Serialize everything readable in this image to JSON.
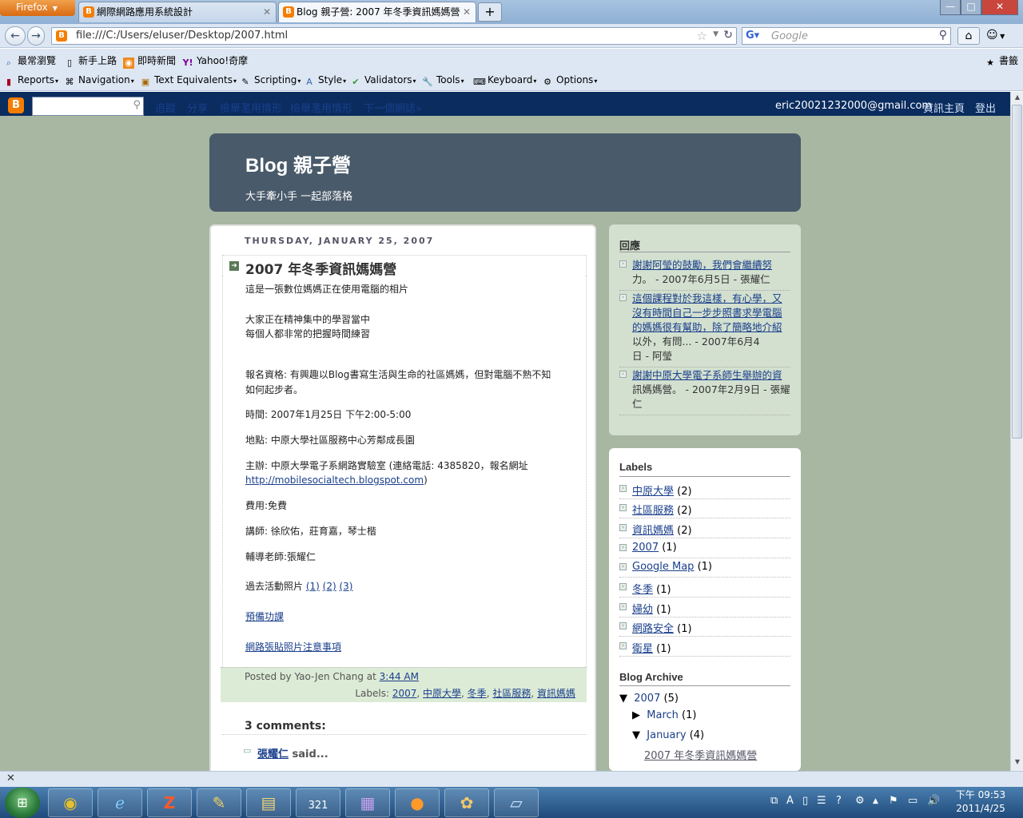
{
  "browser": {
    "app_button": "Firefox",
    "tabs": [
      {
        "label": "網際網路應用系統設計",
        "active": false
      },
      {
        "label": "Blog 親子營: 2007 年冬季資訊媽媽營",
        "active": true
      }
    ],
    "new_tab": "+",
    "url": "file:///C:/Users/eluser/Desktop/2007.html",
    "search_placeholder": "Google",
    "window_buttons": {
      "minimize": "—",
      "maximize": "□",
      "close": "✕"
    }
  },
  "bookmarks": {
    "items": [
      "最常瀏覽",
      "新手上路",
      "即時新聞",
      "Yahoo!奇摩"
    ],
    "right": "書籤"
  },
  "devbar": {
    "items": [
      "Reports",
      "Navigation",
      "Text Equivalents",
      "Scripting",
      "Style",
      "Validators",
      "Tools",
      "Keyboard",
      "Options"
    ]
  },
  "blogger_nav": {
    "links": [
      "追蹤",
      "分享",
      "檢舉濫用情形",
      "檢舉濫用情形",
      "下一個網誌»"
    ],
    "email": "eric20021232000@gmail.com",
    "dashboard": "資訊主頁",
    "signout": "登出"
  },
  "header": {
    "title": "Blog 親子營",
    "description": "大手牽小手 一起部落格"
  },
  "post": {
    "date": "THURSDAY, JANUARY 25, 2007",
    "title": "2007 年冬季資訊媽媽營",
    "lines": [
      "這是一張數位媽媽正在使用電腦的相片",
      "大家正在精神集中的學習當中",
      "每個人都非常的把握時間練習",
      "報名資格: 有興趣以Blog書寫生活與生命的社區媽媽，但對電腦不熟不知",
      "如何起步者。",
      "時間: 2007年1月25日 下午2:00-5:00",
      "地點: 中原大學社區服務中心芳鄰成長園",
      "主辦: 中原大學電子系網路實驗室 (連絡電話: 4385820，報名網址",
      "費用:免費",
      "講師: 徐欣佑，莊育嘉，琴士楷",
      "輔導老師:張耀仁",
      "過去活動照片 "
    ],
    "signup_url": "http://mobilesocialtech.blogspot.com",
    "close_paren": ")",
    "photo_links": [
      "(1)",
      "(2)",
      "(3)"
    ],
    "prep_link": "預備功課",
    "notice_link": "網路張貼照片注意事項",
    "posted_by": "Posted by Yao-Jen Chang at",
    "posted_time": "3:44 AM",
    "labels_prefix": "Labels:",
    "labels": [
      "2007",
      "中原大學",
      "冬季",
      "社區服務",
      "資訊媽媽"
    ],
    "comments_heading": "3 comments:",
    "comment_author": "張耀仁",
    "comment_said": "said..."
  },
  "sidebar": {
    "comments_title": "回應",
    "comments": [
      {
        "lines": [
          "謝謝阿瑩的鼓勵，我們會繼續努",
          "力。 - 2007年6月5日 - 張耀仁"
        ]
      },
      {
        "lines": [
          "這個課程對於我這樣，有心學，又",
          "沒有時間自己一步步照書求學電腦",
          "的媽媽很有幫助，除了簡略地介紹",
          "以外，有問... - 2007年6月4",
          "日 - 阿瑩"
        ]
      },
      {
        "lines": [
          "謝謝中原大學電子系師生舉辦的資",
          "訊媽媽營。 - 2007年2月9日 - 張耀",
          "仁"
        ]
      }
    ],
    "labels_title": "Labels",
    "labels": [
      {
        "name": "中原大學",
        "count": "(2)"
      },
      {
        "name": "社區服務",
        "count": "(2)"
      },
      {
        "name": "資訊媽媽",
        "count": "(2)"
      },
      {
        "name": "2007",
        "count": "(1)"
      },
      {
        "name": "Google Map",
        "count": "(1)"
      },
      {
        "name": "冬季",
        "count": "(1)"
      },
      {
        "name": "婦幼",
        "count": "(1)"
      },
      {
        "name": "網路安全",
        "count": "(1)"
      },
      {
        "name": "衛星",
        "count": "(1)"
      }
    ],
    "archive_title": "Blog Archive",
    "archive": {
      "year": "2007",
      "year_count": "(5)",
      "march": "March",
      "march_count": "(1)",
      "january": "January",
      "january_count": "(4)",
      "post": "2007 年冬季資訊媽媽營"
    }
  },
  "statusbar": {
    "close": "✕"
  },
  "taskbar": {
    "clock_period": "下午 09:53",
    "clock_date": "2011/4/25",
    "apps": [
      "chrome",
      "ie",
      "filezilla",
      "tool",
      "explorer",
      "calendar",
      "winrar",
      "firefox",
      "paint",
      "notepad"
    ]
  }
}
